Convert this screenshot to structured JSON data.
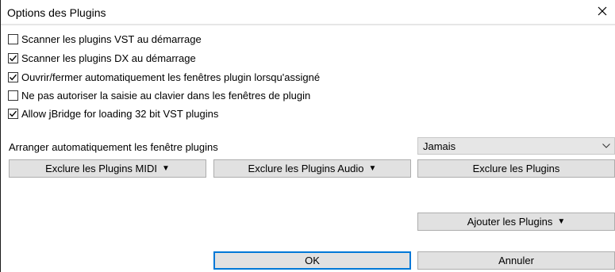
{
  "dialog": {
    "title": "Options des Plugins",
    "close_icon": "close-icon"
  },
  "options": [
    {
      "label": "Scanner les plugins VST au démarrage",
      "checked": false
    },
    {
      "label": "Scanner les plugins DX au démarrage",
      "checked": true
    },
    {
      "label": "Ouvrir/fermer automatiquement les fenêtres plugin lorsqu'assigné",
      "checked": true
    },
    {
      "label": "Ne pas autoriser la saisie au clavier dans les fenêtres de plugin",
      "checked": false
    },
    {
      "label": "Allow jBridge for loading 32 bit VST plugins",
      "checked": true
    }
  ],
  "arrange": {
    "label": "Arranger automatiquement les fenêtre plugins",
    "selected": "Jamais"
  },
  "buttons": {
    "exclude_midi": "Exclure les Plugins MIDI",
    "exclude_audio": "Exclure les Plugins Audio",
    "exclude": "Exclure les Plugins",
    "add": "Ajouter les Plugins",
    "ok": "OK",
    "cancel": "Annuler",
    "dropdown_glyph": "▼"
  },
  "colors": {
    "accent": "#0078d7",
    "button_face": "#e1e1e1",
    "button_border": "#adadad"
  }
}
